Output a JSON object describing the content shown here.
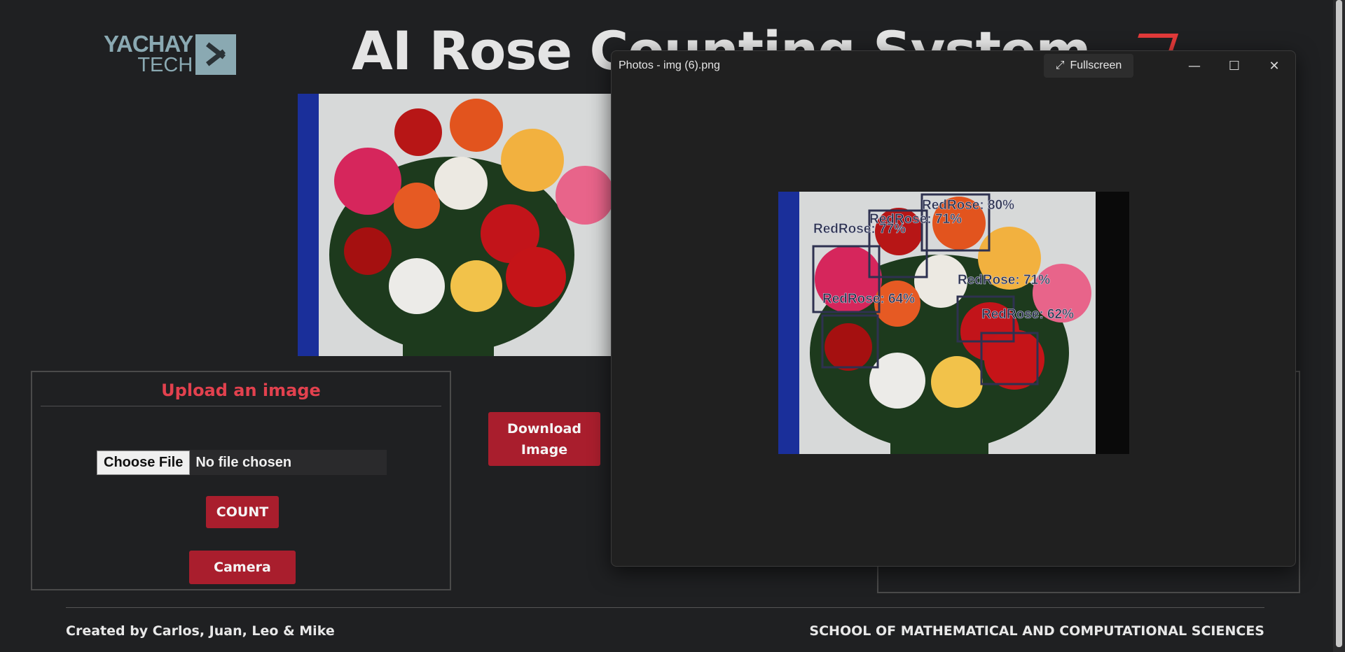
{
  "header": {
    "logo_line1": "YACHAY",
    "logo_line2": "TECH",
    "title": "AI Rose Counting System"
  },
  "upload": {
    "heading": "Upload an image",
    "choose_file": "Choose File",
    "no_file": "No file chosen",
    "count_label": "COUNT",
    "camera_label": "Camera"
  },
  "download_label": "Download Image",
  "footer": {
    "credits": "Created by Carlos, Juan, Leo & Mike",
    "school": "SCHOOL OF MATHEMATICAL AND COMPUTATIONAL SCIENCES"
  },
  "photos_window": {
    "title": "Photos - img (6).png",
    "fullscreen_label": "Fullscreen",
    "detections": [
      {
        "label": "RedRose: 80%"
      },
      {
        "label": "RedRose: 71%"
      },
      {
        "label": "RedRose: 77%"
      },
      {
        "label": "RedRose: 71%"
      },
      {
        "label": "RedRose: 64%"
      },
      {
        "label": "RedRose: 62%"
      }
    ]
  },
  "colors": {
    "accent_red": "#a91e2d",
    "heading_red": "#e2414e",
    "background": "#1f2022",
    "logo_teal": "#8aa9b2"
  }
}
